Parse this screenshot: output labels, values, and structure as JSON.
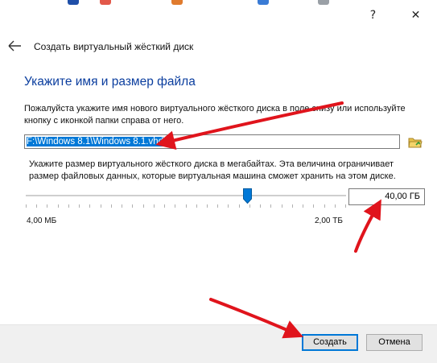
{
  "window": {
    "help_glyph": "?",
    "close_glyph": "✕"
  },
  "header": {
    "title": "Создать виртуальный жёсткий диск"
  },
  "section": {
    "title": "Укажите имя и размер файла"
  },
  "file": {
    "description": "Пожалуйста укажите имя нового виртуального жёсткого диска в поле снизу или используйте кнопку с иконкой папки справа от него.",
    "path": "F:\\Windows 8.1\\Windows 8.1.vhd"
  },
  "size": {
    "description": "Укажите размер виртуального жёсткого диска в мегабайтах. Эта величина ограничивает размер файловых данных, которые виртуальная машина сможет хранить на этом диске.",
    "value": "40,00 ГБ",
    "min_label": "4,00 МБ",
    "max_label": "2,00 ТБ",
    "slider_fraction": 0.69
  },
  "buttons": {
    "create": "Создать",
    "cancel": "Отмена"
  },
  "colors": {
    "accent": "#0078d7",
    "title_blue": "#0a3d9e",
    "annotation_red": "#e0141c"
  }
}
